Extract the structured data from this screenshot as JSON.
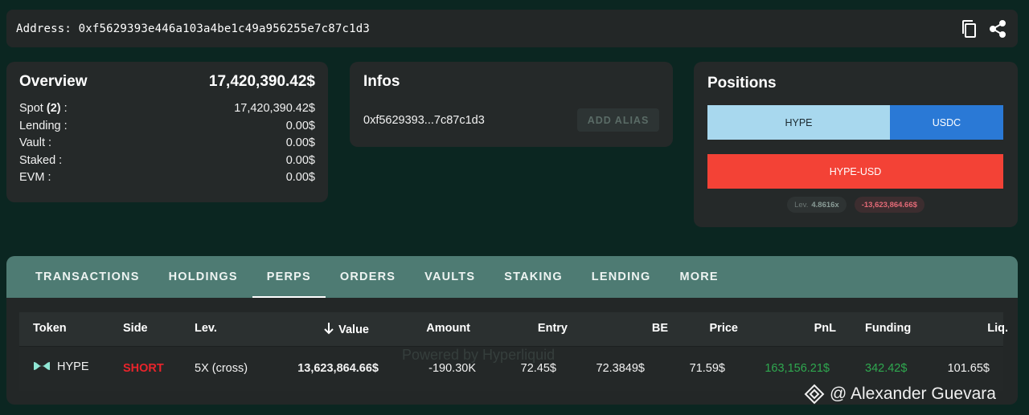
{
  "address_bar": {
    "label": "Address: 0xf5629393e446a103a4be1c49a956255e7c87c1d3",
    "copy_icon": "copy-icon",
    "share_icon": "share-icon"
  },
  "overview": {
    "title": "Overview",
    "total": "17,420,390.42$",
    "rows": [
      {
        "label_pre": "Spot ",
        "label_bold": "(2)",
        "label_post": " :",
        "value": "17,420,390.42$"
      },
      {
        "label_pre": "Lending :",
        "label_bold": "",
        "label_post": "",
        "value": "0.00$"
      },
      {
        "label_pre": "Vault :",
        "label_bold": "",
        "label_post": "",
        "value": "0.00$"
      },
      {
        "label_pre": "Staked :",
        "label_bold": "",
        "label_post": "",
        "value": "0.00$"
      },
      {
        "label_pre": "EVM :",
        "label_bold": "",
        "label_post": "",
        "value": "0.00$"
      }
    ]
  },
  "infos": {
    "title": "Infos",
    "short_address": "0xf5629393...7c87c1d3",
    "add_alias": "ADD ALIAS"
  },
  "positions": {
    "title": "Positions",
    "spot_split": [
      {
        "label": "HYPE",
        "color": "#a8d8ee"
      },
      {
        "label": "USDC",
        "color": "#2a79d6"
      }
    ],
    "perp_bar": {
      "label": "HYPE-USD",
      "color": "#f34236"
    },
    "lev_label": "Lev.",
    "lev_value": "4.8616x",
    "pnl_value": "-13,623,864.66$"
  },
  "tabs": [
    "TRANSACTIONS",
    "HOLDINGS",
    "PERPS",
    "ORDERS",
    "VAULTS",
    "STAKING",
    "LENDING",
    "MORE"
  ],
  "active_tab": "PERPS",
  "table": {
    "headers": [
      "Token",
      "Side",
      "Lev.",
      "Value",
      "Amount",
      "Entry",
      "BE",
      "Price",
      "PnL",
      "Funding",
      "Liq."
    ],
    "rows": [
      {
        "token": "HYPE",
        "side": "SHORT",
        "lev": "5X (cross)",
        "value": "13,623,864.66$",
        "amount": "-190.30K",
        "entry": "72.45$",
        "be": "72.3849$",
        "price": "71.59$",
        "pnl": "163,156.21$",
        "funding": "342.42$",
        "liq": "101.65$"
      }
    ],
    "watermark": "Powered by Hyperliquid"
  },
  "credit": "@ Alexander Guevara",
  "colors": {
    "short": "#e8242b",
    "positive": "#2fa84f",
    "accent_tabs": "#4e7b73"
  }
}
